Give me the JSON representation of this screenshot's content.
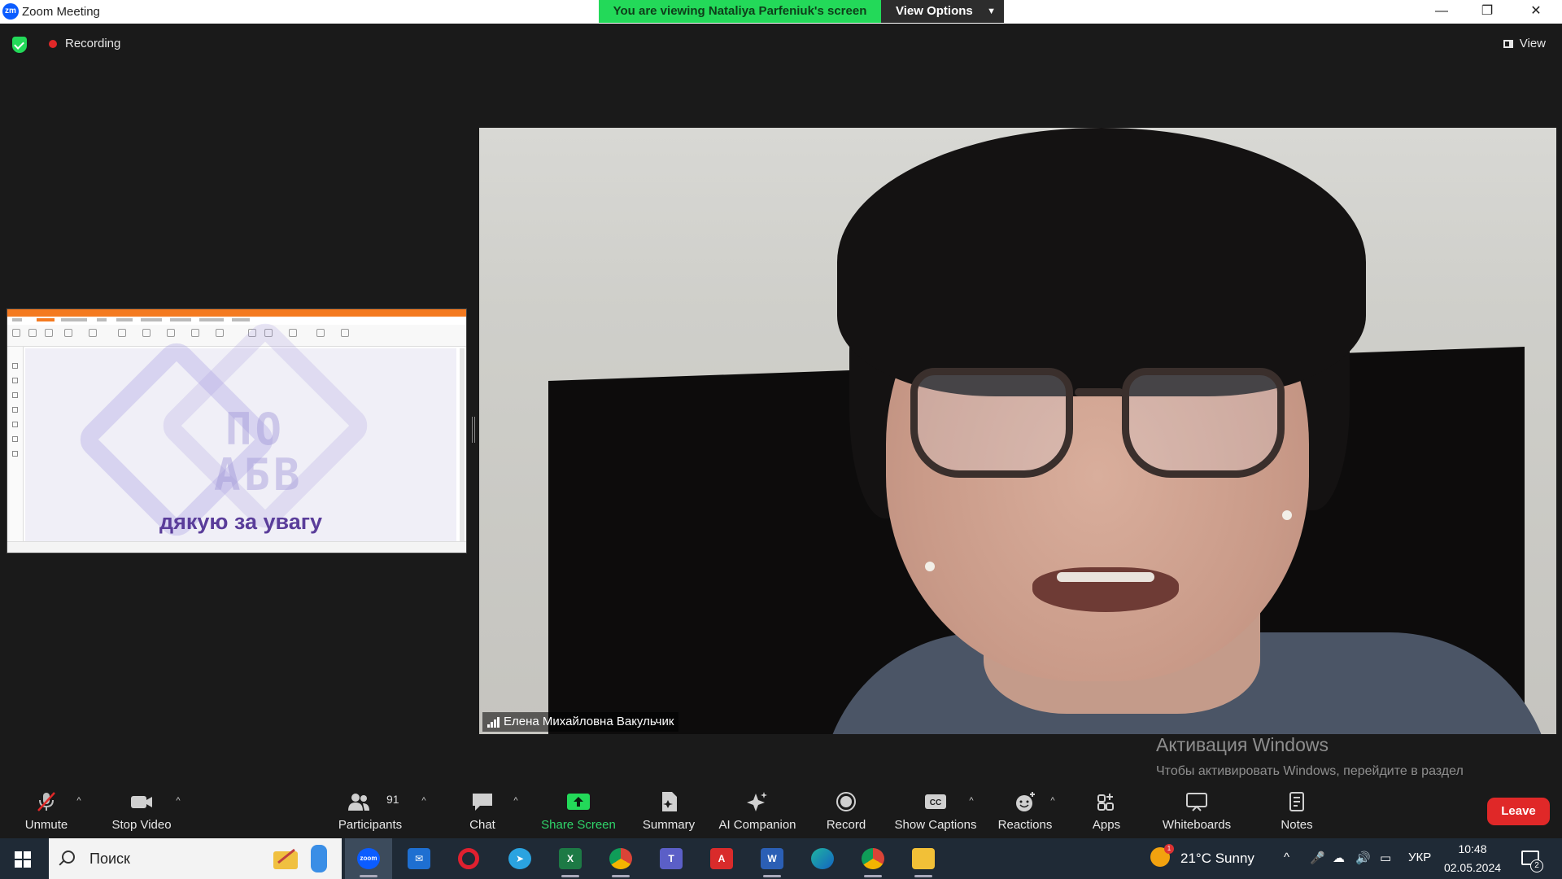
{
  "window": {
    "app_icon_text": "zm",
    "title": "Zoom Meeting",
    "viewing_banner": "You are viewing Nataliya Parfeniuk's screen",
    "view_options": "View Options"
  },
  "meeting_bar": {
    "recording": "Recording",
    "view": "View"
  },
  "shared_screen": {
    "slide_text": "дякую за увагу",
    "logo_line1": "ПО",
    "logo_line2": "АБВ"
  },
  "speaker": {
    "name": "Елена Михайловна Вакульчик"
  },
  "activation": {
    "title": "Активация Windows",
    "subtitle": "Чтобы активировать Windows, перейдите в раздел \"Параметры\"."
  },
  "toolbar": {
    "unmute": "Unmute",
    "stop_video": "Stop Video",
    "participants": "Participants",
    "participants_count": "91",
    "chat": "Chat",
    "share_screen": "Share Screen",
    "summary": "Summary",
    "ai_companion": "AI Companion",
    "record": "Record",
    "show_captions": "Show Captions",
    "reactions": "Reactions",
    "apps": "Apps",
    "whiteboards": "Whiteboards",
    "notes": "Notes",
    "leave": "Leave",
    "accent_green": "#23d959",
    "leave_red": "#e02828"
  },
  "taskbar": {
    "search": "Поиск",
    "zoom_label": "zoom",
    "weather": "21°C  Sunny",
    "language": "УКР",
    "time": "10:48",
    "date": "02.05.2024",
    "notifications": "2"
  }
}
